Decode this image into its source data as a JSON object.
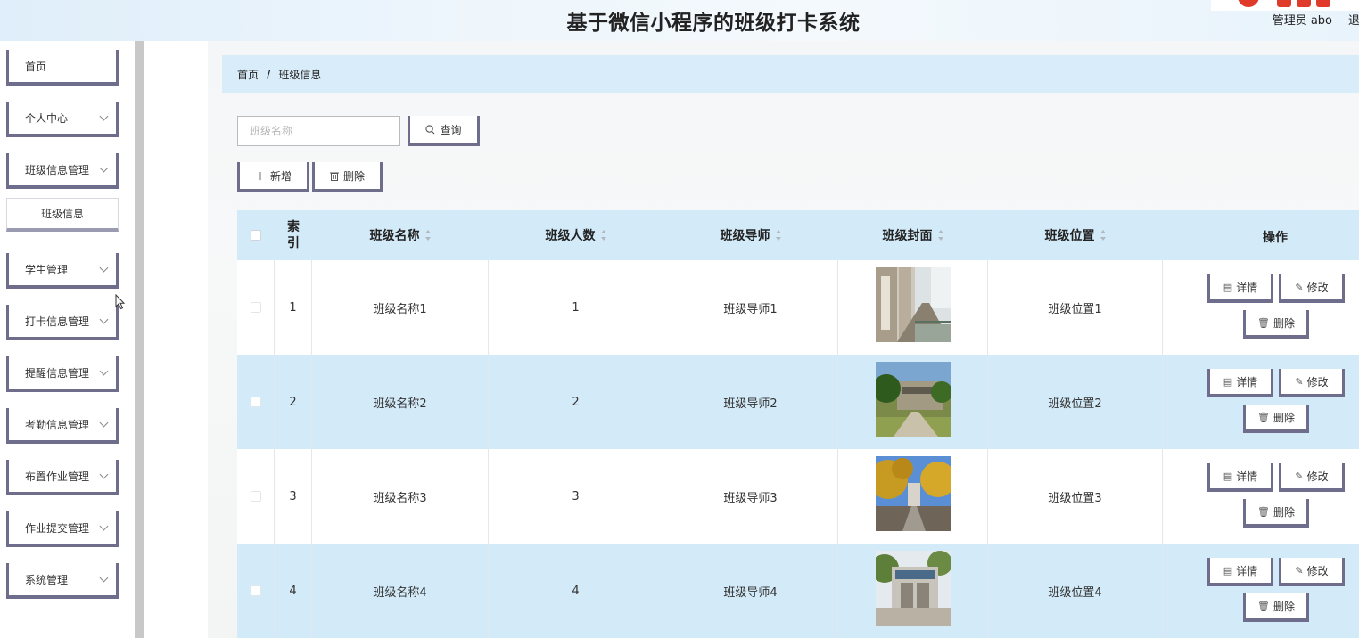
{
  "header": {
    "title": "基于微信小程序的班级打卡系统",
    "user_label": "管理员 abo",
    "logout_label": "退出"
  },
  "sidebar": {
    "items": [
      {
        "label": "首页",
        "has_chevron": false
      },
      {
        "label": "个人中心",
        "has_chevron": true
      },
      {
        "label": "班级信息管理",
        "has_chevron": true
      },
      {
        "label": "学生管理",
        "has_chevron": true
      },
      {
        "label": "打卡信息管理",
        "has_chevron": true
      },
      {
        "label": "提醒信息管理",
        "has_chevron": true
      },
      {
        "label": "考勤信息管理",
        "has_chevron": true
      },
      {
        "label": "布置作业管理",
        "has_chevron": true
      },
      {
        "label": "作业提交管理",
        "has_chevron": true
      },
      {
        "label": "系统管理",
        "has_chevron": true
      }
    ],
    "subitem": {
      "label": "班级信息"
    }
  },
  "breadcrumb": {
    "home": "首页",
    "separator": "/",
    "current": "班级信息"
  },
  "search": {
    "placeholder": "班级名称",
    "value": "",
    "button_label": "查询"
  },
  "toolbar": {
    "add_label": "新增",
    "delete_label": "删除"
  },
  "table": {
    "headers": {
      "index": "索\n引",
      "name": "班级名称",
      "count": "班级人数",
      "tutor": "班级导师",
      "cover": "班级封面",
      "location": "班级位置",
      "actions": "操作"
    },
    "rows": [
      {
        "index": "1",
        "name": "班级名称1",
        "count": "1",
        "tutor": "班级导师1",
        "location": "班级位置1"
      },
      {
        "index": "2",
        "name": "班级名称2",
        "count": "2",
        "tutor": "班级导师2",
        "location": "班级位置2"
      },
      {
        "index": "3",
        "name": "班级名称3",
        "count": "3",
        "tutor": "班级导师3",
        "location": "班级位置3"
      },
      {
        "index": "4",
        "name": "班级名称4",
        "count": "4",
        "tutor": "班级导师4",
        "location": "班级位置4"
      }
    ],
    "row_actions": {
      "detail": "详情",
      "edit": "修改",
      "delete": "删除"
    }
  },
  "colors": {
    "header_bg": "#d3eaf8",
    "button_border": "#6e6e8c",
    "breadcrumb_bg": "#d9ecf9"
  }
}
